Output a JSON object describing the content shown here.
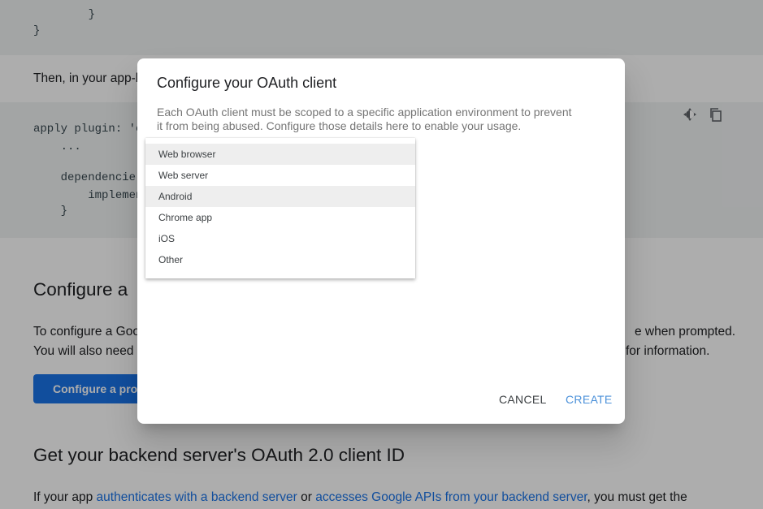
{
  "background_page": {
    "code_top": {
      "red_fragment": "",
      "lines": [
        "    }",
        "}"
      ]
    },
    "then_text": "Then, in your app-l",
    "code_mid": {
      "lines": [
        "apply plugin: 'c",
        "    ...",
        "",
        "    dependencie",
        "        implemen",
        "    }"
      ]
    },
    "section1_heading": "Configure a",
    "section1_para": {
      "line1_left": "To configure a Goo",
      "line1_right": "e when prompted.",
      "line2_left": "You will also need",
      "line2_right": "for information."
    },
    "configure_project_button": "Configure a proj",
    "section2_heading": "Get your backend server's OAuth 2.0 client ID",
    "section2_para": {
      "prefix": "If your app ",
      "link1": "authenticates with a backend server",
      "middle": " or ",
      "link2": "accesses Google APIs from your backend server",
      "suffix": ", you must get the"
    },
    "code_tool_icons": [
      "dark-theme-icon",
      "copy-icon"
    ]
  },
  "dialog": {
    "title": "Configure your OAuth client",
    "description": "Each OAuth client must be scoped to a specific application environment to prevent it from being abused. Configure those details here to enable your usage.",
    "dropdown_options": [
      {
        "label": "Web browser",
        "highlighted": true
      },
      {
        "label": "Web server",
        "highlighted": false
      },
      {
        "label": "Android",
        "highlighted": true
      },
      {
        "label": "Chrome app",
        "highlighted": false
      },
      {
        "label": "iOS",
        "highlighted": false
      },
      {
        "label": "Other",
        "highlighted": false
      }
    ],
    "cancel_label": "CANCEL",
    "create_label": "CREATE"
  },
  "colors": {
    "link": "#1a73e8",
    "primary_button": "#1a73e8",
    "create_text": "#4a90d9",
    "overlay": "rgba(0,0,0,0.32)",
    "code_background": "#f1f3f4"
  }
}
